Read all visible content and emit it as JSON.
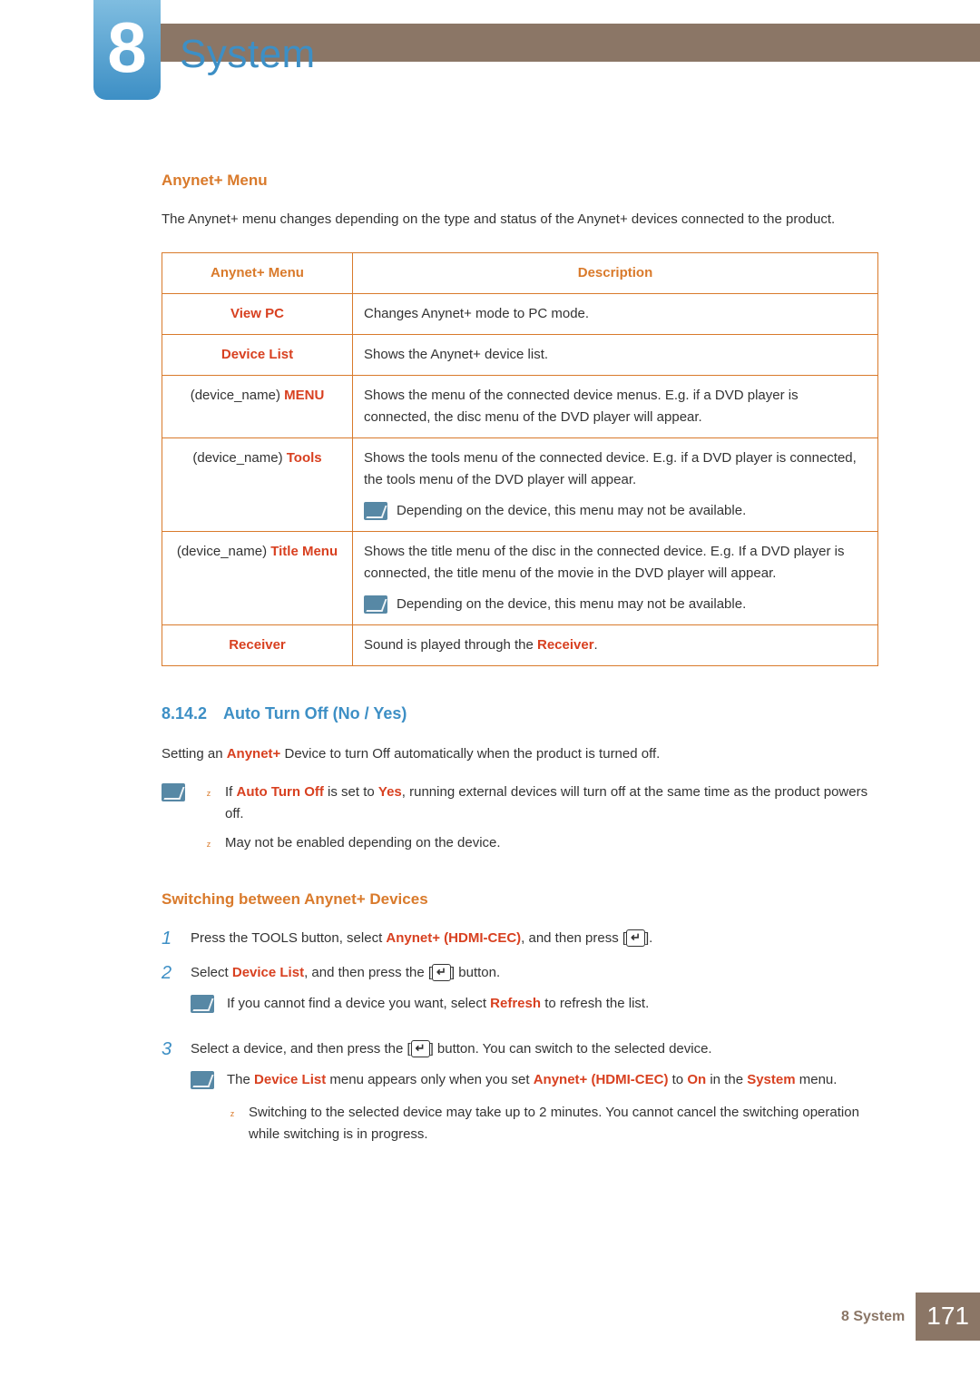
{
  "chapter": {
    "number": "8",
    "title": "System"
  },
  "section1": {
    "heading": "Anynet+ Menu",
    "intro": "The Anynet+ menu changes depending on the type and status of the Anynet+ devices connected to the product.",
    "table": {
      "head_menu": "Anynet+ Menu",
      "head_desc": "Description",
      "rows": {
        "r0": {
          "menu_hl": "View PC",
          "desc": "Changes Anynet+ mode to PC mode."
        },
        "r1": {
          "menu_hl": "Device List",
          "desc": "Shows the Anynet+ device list."
        },
        "r2": {
          "menu_pre": "(device_name) ",
          "menu_hl": "MENU",
          "desc": "Shows the menu of the connected device menus. E.g. if a DVD player is connected, the disc menu of the DVD player will appear."
        },
        "r3": {
          "menu_pre": "(device_name) ",
          "menu_hl": "Tools",
          "desc": "Shows the tools menu of the connected device. E.g. if a DVD player is connected, the tools menu of the DVD player will appear.",
          "note": "Depending on the device, this menu may not be available."
        },
        "r4": {
          "menu_pre": "(device_name) ",
          "menu_hl": "Title Menu",
          "desc": "Shows the title menu of the disc in the connected device. E.g. If a DVD player is connected, the title menu of the movie in the DVD player will appear.",
          "note": "Depending on the device, this menu may not be available."
        },
        "r5": {
          "menu_hl": "Receiver",
          "desc_pre": "Sound is played through the ",
          "desc_hl": "Receiver",
          "desc_post": "."
        }
      }
    }
  },
  "section2": {
    "number": "8.14.2",
    "title": "Auto Turn Off (No / Yes)",
    "intro_pre": "Setting an ",
    "intro_hl": "Anynet+",
    "intro_post": " Device to turn Off automatically when the product is turned off.",
    "notes": {
      "n0": {
        "pre": "If ",
        "hl1": "Auto Turn Off",
        "mid": " is set to ",
        "hl2": "Yes",
        "post": ", running external devices will turn off at the same time as the product powers off."
      },
      "n1": {
        "text": "May not be enabled depending on the device."
      }
    }
  },
  "section3": {
    "heading": "Switching between Anynet+ Devices",
    "steps": {
      "s1": {
        "pre": "Press the ",
        "b1": "TOOLS",
        "mid1": " button, select ",
        "hl1": "Anynet+ (HDMI-CEC)",
        "mid2": ", and then press [",
        "post": "]."
      },
      "s2": {
        "pre": "Select ",
        "hl1": "Device List",
        "mid": ", and then press the [",
        "post": "] button.",
        "note": {
          "pre": "If you cannot find a device you want, select ",
          "hl": "Refresh",
          "post": " to refresh the list."
        }
      },
      "s3": {
        "pre": "Select a device, and then press the [",
        "post": "] button. You can switch to the selected device.",
        "note": {
          "pre": "The ",
          "hl1": "Device List",
          "mid1": " menu appears only when you set ",
          "hl2": "Anynet+ (HDMI-CEC)",
          "mid2": " to ",
          "hl3": "On",
          "mid3": " in the ",
          "hl4": "System",
          "post": " menu."
        },
        "sub": "Switching to the selected device may take up to 2 minutes. You cannot cancel the switching operation while switching is in progress."
      }
    }
  },
  "footer": {
    "label": "8 System",
    "page": "171"
  }
}
